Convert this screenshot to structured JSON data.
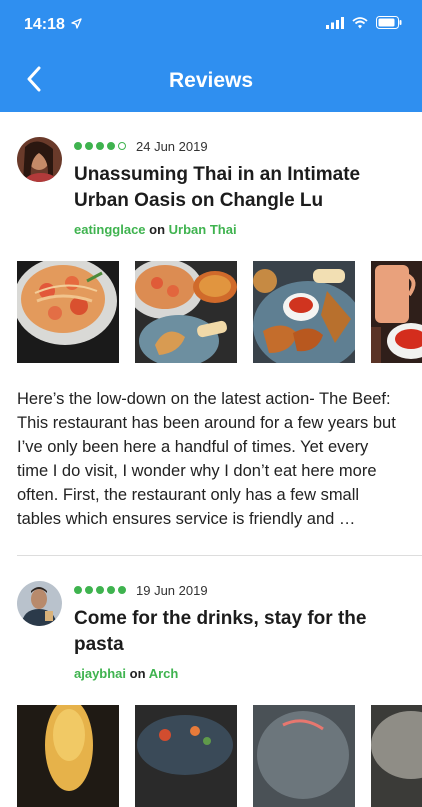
{
  "status": {
    "time": "14:18"
  },
  "nav": {
    "title": "Reviews"
  },
  "reviews": [
    {
      "date": "24 Jun 2019",
      "rating": 4,
      "title": "Unassuming Thai in an Intimate Urban Oasis on Changle Lu",
      "author": "eatingglace",
      "on_word": "on",
      "venue": "Urban Thai",
      "body": "Here’s the low-down on the latest action- The Beef: This restaurant has been around for a few years but I’ve only been here a handful of times. Yet every time I do visit, I wonder why I don’t eat here more often. First, the restaurant only has a few small tables which ensures service is friendly and …"
    },
    {
      "date": "19 Jun 2019",
      "rating": 5,
      "title": "Come for the drinks, stay for the pasta",
      "author": "ajaybhai",
      "on_word": "on",
      "venue": "Arch"
    }
  ]
}
